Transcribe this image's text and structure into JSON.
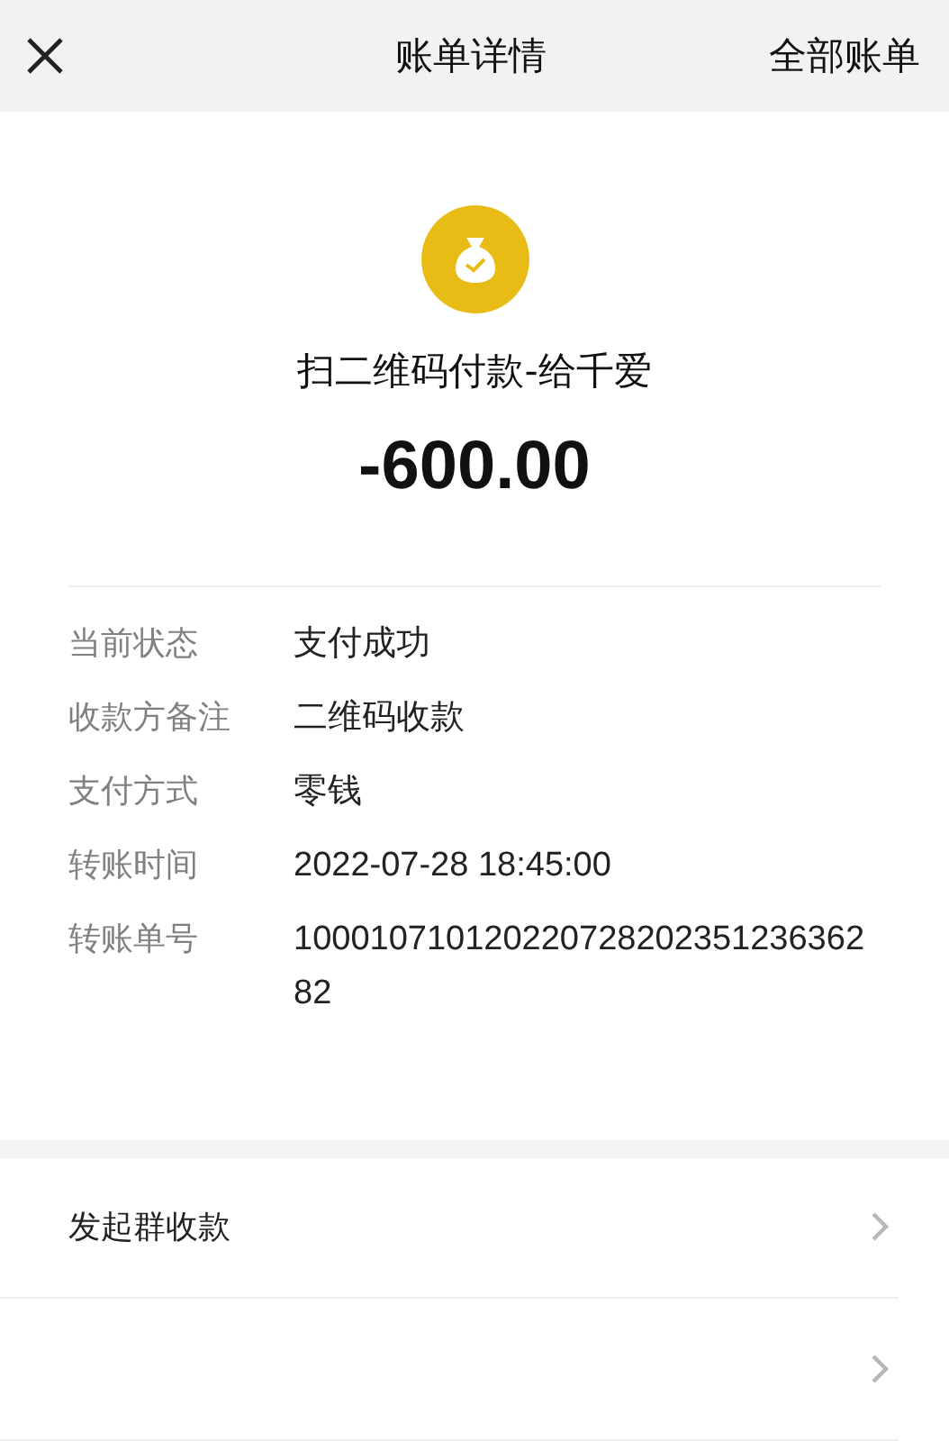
{
  "header": {
    "title": "账单详情",
    "right_link": "全部账单"
  },
  "summary": {
    "title": "扫二维码付款-给千爱",
    "amount": "-600.00"
  },
  "details": [
    {
      "label": "当前状态",
      "value": "支付成功"
    },
    {
      "label": "收款方备注",
      "value": "二维码收款"
    },
    {
      "label": "支付方式",
      "value": "零钱"
    },
    {
      "label": "转账时间",
      "value": "2022-07-28 18:45:00"
    },
    {
      "label": "转账单号",
      "value": "100010710120220728202351236362 82"
    }
  ],
  "actions": [
    {
      "kind": "labeled",
      "label": "发起群收款"
    },
    {
      "kind": "chevron_only"
    }
  ]
}
